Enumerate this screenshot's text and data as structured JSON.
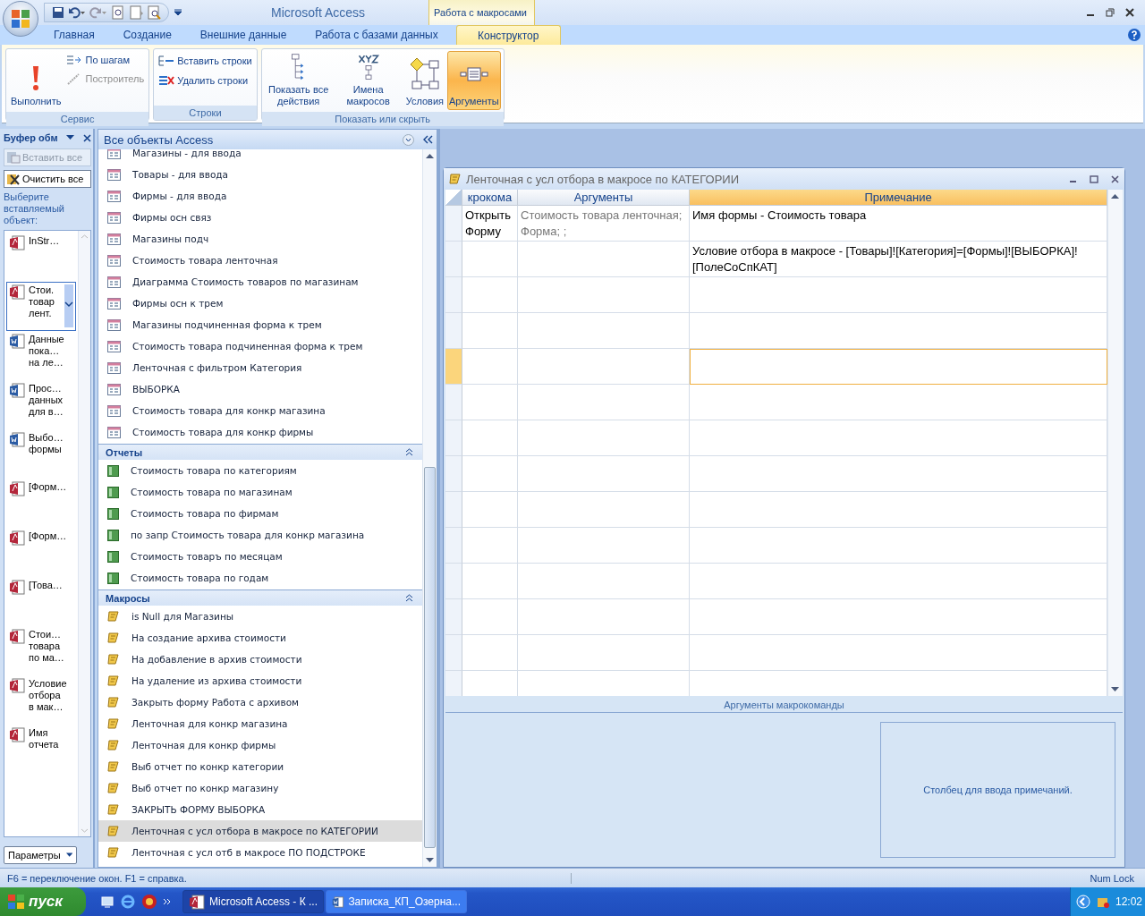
{
  "title_bar": {
    "app_title": "Microsoft Access",
    "contextual_group": "Работа с макросами"
  },
  "tabs": [
    {
      "label": "Главная",
      "selected": false
    },
    {
      "label": "Создание",
      "selected": false
    },
    {
      "label": "Внешние данные",
      "selected": false
    },
    {
      "label": "Работа с базами данных",
      "selected": false
    },
    {
      "label": "Конструктор",
      "selected": true
    }
  ],
  "ribbon": [
    {
      "title": "Сервис",
      "large_buttons": [
        {
          "label": "Выполнить",
          "kind": "run",
          "selected": false
        }
      ],
      "small_buttons": [
        {
          "label": "По шагам",
          "kind": "step",
          "disabled": false
        },
        {
          "label": "Построитель",
          "kind": "builder",
          "disabled": true
        }
      ]
    },
    {
      "title": "Строки",
      "small_buttons": [
        {
          "label": "Вставить строки",
          "kind": "insert",
          "disabled": false
        },
        {
          "label": "Удалить строки",
          "kind": "delete",
          "disabled": false
        }
      ]
    },
    {
      "title": "Показать или скрыть",
      "large_buttons": [
        {
          "label": "Показать все действия",
          "kind": "actions",
          "selected": false
        },
        {
          "label": "Имена макросов",
          "kind": "names",
          "selected": false
        },
        {
          "label": "Условия",
          "kind": "conditions",
          "selected": false
        },
        {
          "label": "Аргументы",
          "kind": "arguments",
          "selected": true
        }
      ]
    }
  ],
  "clipboard": {
    "title": "Буфер обм",
    "paste_all": {
      "label": "Вставить все",
      "disabled": true
    },
    "clear_all": {
      "label": "Очистить все",
      "disabled": false
    },
    "hint": "Выберите вставляемый объект:",
    "items": [
      {
        "text": "InStr…",
        "kind": "access",
        "selected": false
      },
      {
        "text": "Стои.\nтовар\nлент.",
        "kind": "access",
        "selected": true
      },
      {
        "text": "Данные\nпока…\nна ле…",
        "kind": "word",
        "selected": false
      },
      {
        "text": "Прос…\nданных\nдля в…",
        "kind": "word",
        "selected": false
      },
      {
        "text": "Выбо…\nформы",
        "kind": "word",
        "selected": false
      },
      {
        "text": "[Форм…",
        "kind": "access",
        "selected": false
      },
      {
        "text": "[Форм…",
        "kind": "access",
        "selected": false
      },
      {
        "text": "[Това…",
        "kind": "access",
        "selected": false
      },
      {
        "text": "Стои…\nтовара\nпо ма…",
        "kind": "access",
        "selected": false
      },
      {
        "text": "Условие\nотбора\nв мак…",
        "kind": "access",
        "selected": false
      },
      {
        "text": "Имя\nотчета",
        "kind": "access",
        "selected": false
      }
    ],
    "options_button": "Параметры"
  },
  "navigation": {
    "title": "Все объекты Access",
    "groups": [
      {
        "kind": "form",
        "items": [
          {
            "label": "Магазины - для ввода",
            "selected": false
          },
          {
            "label": "Товары - для ввода",
            "selected": false
          },
          {
            "label": "Фирмы - для ввода",
            "selected": false
          },
          {
            "label": "Фирмы осн связ",
            "selected": false
          },
          {
            "label": "Магазины подч",
            "selected": false
          },
          {
            "label": "Стоимость товара ленточная",
            "selected": false
          },
          {
            "label": "Диаграмма Стоимость товаров по  магазинам",
            "selected": false
          },
          {
            "label": "Фирмы осн к трем",
            "selected": false
          },
          {
            "label": "Магазины подчиненная форма к трем",
            "selected": false
          },
          {
            "label": "Стоимость товара подчиненная форма к трем",
            "selected": false
          },
          {
            "label": "Ленточная с фильтром Категория",
            "selected": false
          },
          {
            "label": "ВЫБОРКА",
            "selected": false
          },
          {
            "label": "Стоимость товара для конкр магазина",
            "selected": false
          },
          {
            "label": "Стоимость товара для конкр фирмы",
            "selected": false
          }
        ]
      },
      {
        "kind": "report",
        "title": "Отчеты",
        "expanded": true,
        "items": [
          {
            "label": "Стоимость товара по категориям",
            "selected": false
          },
          {
            "label": "Стоимость товара по магазинам",
            "selected": false
          },
          {
            "label": "Стоимость товара по фирмам",
            "selected": false
          },
          {
            "label": "по запр Стоимость товара для конкр магазина",
            "selected": false
          },
          {
            "label": "Стоимость товаръ по месяцам",
            "selected": false
          },
          {
            "label": "Стоимость товара по годам",
            "selected": false
          }
        ]
      },
      {
        "kind": "macro",
        "title": "Макросы",
        "expanded": true,
        "items": [
          {
            "label": "is Null для Магазины",
            "selected": false
          },
          {
            "label": "На создание архива стоимости",
            "selected": false
          },
          {
            "label": "На добавление в архив стоимости",
            "selected": false
          },
          {
            "label": "На удаление из архива стоимости",
            "selected": false
          },
          {
            "label": "Закрыть форму Работа с архивом",
            "selected": false
          },
          {
            "label": "Ленточная для конкр магазина",
            "selected": false
          },
          {
            "label": "Ленточная для конкр фирмы",
            "selected": false
          },
          {
            "label": "Выб отчет по конкр категории",
            "selected": false
          },
          {
            "label": "Выб отчет по конкр магазину",
            "selected": false
          },
          {
            "label": "ЗАКРЫТЬ ФОРМУ ВЫБОРКА",
            "selected": false
          },
          {
            "label": "Ленточная с усл отбора в макросе по КАТЕГОРИИ",
            "selected": true
          },
          {
            "label": "Ленточная с усл отб в макросе ПО ПОДСТРОКЕ",
            "selected": false
          }
        ]
      }
    ]
  },
  "macro_window": {
    "title": "Ленточная с усл отбора в макросе по КАТЕГОРИИ",
    "columns": [
      "крокома",
      "Аргументы",
      "Примечание"
    ],
    "rows": [
      {
        "selected": false,
        "action": "Открыть Форму",
        "arguments": "Стоимость товара ленточная; Форма; ;",
        "comment": "Имя формы - Стоимость товара"
      },
      {
        "selected": false,
        "comment": "Условие отбора в макросе - [Товары]![Категория]=[Формы]![ВЫБОРКА]![ПолеСоСпКАТ]"
      },
      {
        "selected": false
      },
      {
        "selected": false
      },
      {
        "selected": true
      },
      {
        "selected": false
      },
      {
        "selected": false
      },
      {
        "selected": false
      },
      {
        "selected": false
      },
      {
        "selected": false
      },
      {
        "selected": false
      },
      {
        "selected": false
      },
      {
        "selected": false
      },
      {
        "selected": false
      }
    ],
    "arguments_title": "Аргументы макрокоманды",
    "help_text": "Столбец для ввода примечаний."
  },
  "status_bar": {
    "message": "F6 = переключение окон.  F1 = справка.",
    "indicator": "Num Lock"
  },
  "taskbar": {
    "start": "пуск",
    "tasks": [
      {
        "label": "Microsoft Access - К ...",
        "kind": "access",
        "selected": true
      },
      {
        "label": "Записка_КП_Озерна...",
        "kind": "word",
        "selected": false
      }
    ],
    "clock": "12:02"
  }
}
